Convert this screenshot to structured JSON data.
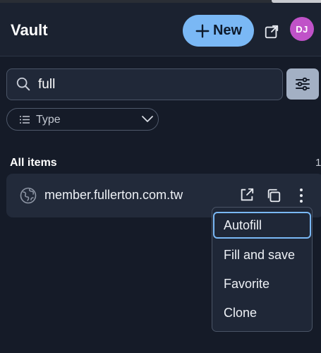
{
  "header": {
    "title": "Vault",
    "new_button_label": "New",
    "avatar_initials": "DJ",
    "accent_color": "#7ab8f5",
    "avatar_color": "#c052c8"
  },
  "search": {
    "value": "full"
  },
  "filter": {
    "type_label": "Type"
  },
  "section": {
    "title": "All items",
    "count": "1"
  },
  "items": [
    {
      "name": "member.fullerton.com.tw",
      "icon": "globe-icon"
    }
  ],
  "menu": {
    "items": [
      {
        "label": "Autofill",
        "focused": true
      },
      {
        "label": "Fill and save",
        "focused": false
      },
      {
        "label": "Favorite",
        "focused": false
      },
      {
        "label": "Clone",
        "focused": false
      }
    ]
  }
}
